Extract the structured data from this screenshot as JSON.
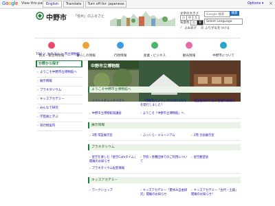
{
  "translate_bar": {
    "view_label": "View this page in:",
    "language": "English",
    "translate_label": "Translate",
    "turn_off_label": "Turn off for: Japanese",
    "options_label": "Options ▾",
    "close_label": "×"
  },
  "header": {
    "logo_text": "中野市",
    "tagline": "「信州」のふるさと",
    "font_size_label": "文字の大きさ",
    "size_small": "小",
    "size_medium": "中",
    "size_large": "大",
    "color_label": "背景色",
    "color_a": "白",
    "color_b": "黒",
    "yomiage_label": "よみあげ",
    "furigana_label": "ふりがなをつける",
    "search_label": "Google 検索",
    "search_button": "検索",
    "select_language": "Select Language"
  },
  "nav": {
    "items": [
      {
        "label": "防災・緊急時情報",
        "color": "#e94b6a"
      },
      {
        "label": "暮らしの情報",
        "color": "#f2a23a"
      },
      {
        "label": "行政情報",
        "color": "#3a9be0"
      },
      {
        "label": "産業・ビジネス",
        "color": "#45b86a"
      },
      {
        "label": "観光情報",
        "color": "#e66aa8"
      },
      {
        "label": "中野市について",
        "color": "#2aa6c7"
      }
    ]
  },
  "breadcrumb": "TOP ＞ カテゴリ ＞ 市立博物館",
  "sidebar": {
    "heading": "分野から探す",
    "items": [
      "ようこそ中野市立博物館へ",
      "展示情報",
      "プラネタリウム",
      "キッズアカデミー",
      "みんなで研究",
      "学芸員と学ぶ",
      "刊行物案内"
    ]
  },
  "main": {
    "title": "中野市立博物館",
    "sections": [
      {
        "heading": "ようこそ中野市立博物館へ",
        "links": [
          "イベントチェックリスト",
          "「博物館だより」2022年11月号を発行しました！",
          "施設使用料に係る各種申請様式",
          "中野市立博物館協議会",
          "ようこそ「中野市立博物館」へ"
        ]
      },
      {
        "heading": "展示情報",
        "links": [
          "1階 常設展示室",
          "ふっくら・ミュージアム",
          "2階 企画展示室"
        ]
      },
      {
        "heading": "プラネタリウム",
        "links": [
          "星空を楽しむ「星空Cafeタイム」開催のお知らせ",
          "学校・各種団体でのご利用について",
          "星空観望会",
          "プラネタリウム投影情報"
        ]
      },
      {
        "heading": "キッズアカデミー",
        "links": [
          "ワークショップ",
          "キッズアカデミー「夏休み自由研究」開催のお知らせ",
          "キッズアカデミー「古代・土器」開催のお知らせ！"
        ]
      }
    ]
  },
  "colors": {
    "accent_green": "#1e7c3a",
    "link_blue": "#1a0dab"
  }
}
